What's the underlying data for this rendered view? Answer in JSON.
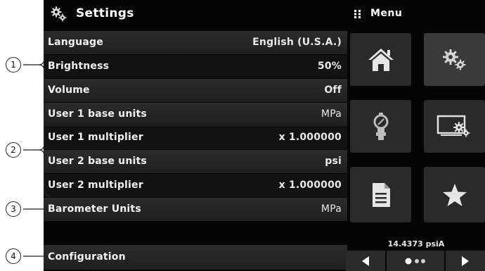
{
  "settings": {
    "title": "Settings"
  },
  "menu": {
    "title": "Menu"
  },
  "rows": [
    {
      "label": "Language",
      "value": "English (U.S.A.)"
    },
    {
      "label": "Brightness",
      "value": "50%"
    },
    {
      "label": "Volume",
      "value": "Off"
    },
    {
      "label": "User 1 base units",
      "value": "MPa"
    },
    {
      "label": "User 1 multiplier",
      "value": "x 1.000000"
    },
    {
      "label": "User 2 base units",
      "value": "psi"
    },
    {
      "label": "User 2 multiplier",
      "value": "x 1.000000"
    },
    {
      "label": "Barometer Units",
      "value": "MPa"
    },
    {
      "label": "Configuration",
      "value": ""
    }
  ],
  "status": {
    "pressure": "14.4373 psiA"
  },
  "callouts": [
    "1",
    "2",
    "3",
    "4"
  ],
  "icons": {
    "settings": "gears-icon",
    "menu": "grid-dots-icon",
    "tiles": [
      "home-icon",
      "gears-icon",
      "pressure-gauge-icon",
      "display-settings-icon",
      "document-icon",
      "star-icon"
    ],
    "nav": [
      "arrow-left-icon",
      "page-dots-icon",
      "arrow-right-icon"
    ]
  },
  "colors": {
    "screen": "#050505",
    "row_shaded": "#2c2c2c",
    "tile": "#2a2a2a",
    "text": "#f2f2f2"
  }
}
